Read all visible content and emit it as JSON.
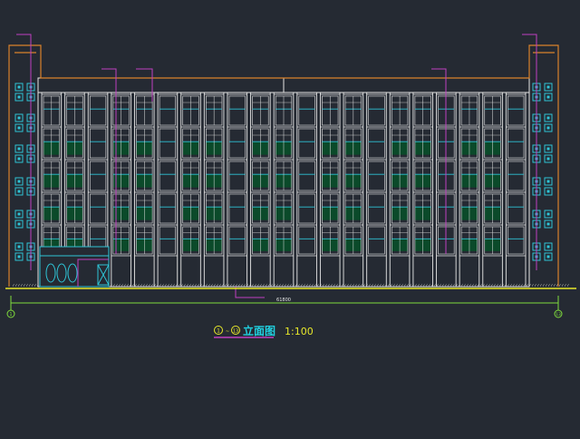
{
  "drawing": {
    "title_cn": "立面图",
    "scale": "1:100",
    "axis_start_label": "1",
    "axis_end_label": "13",
    "axis_range_label": "1~13",
    "total_dimension": "61800"
  },
  "colors": {
    "background": "#252a33",
    "outline_white": "#e6e6e6",
    "parapet_orange": "#d9822b",
    "window_cyan": "#2ec4d6",
    "leader_magenta": "#c040c0",
    "ground_yellow": "#e8e82a",
    "grid_green": "#7fdc3c",
    "glass_green": "#0b4a2a",
    "title_cyan": "#20d0e0",
    "title_yellow": "#e8e82a"
  }
}
